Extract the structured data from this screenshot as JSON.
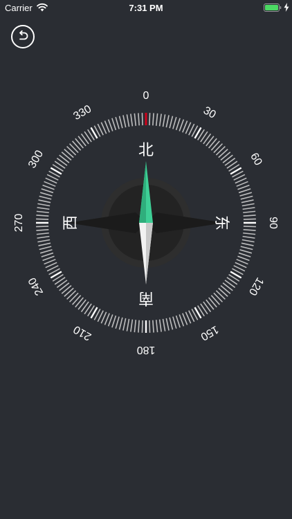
{
  "status_bar": {
    "carrier": "Carrier",
    "time": "7:31 PM",
    "icons": [
      "wifi-icon",
      "battery-icon",
      "charging-icon"
    ],
    "battery_color": "#4cd964"
  },
  "back_button": {
    "icon": "back-arrow-icon"
  },
  "compass": {
    "heading": 0,
    "degree_labels": [
      "0",
      "30",
      "60",
      "90",
      "120",
      "150",
      "180",
      "210",
      "240",
      "270",
      "300",
      "330"
    ],
    "directions": {
      "north": "北",
      "east": "东",
      "south": "南",
      "west": "西"
    },
    "colors": {
      "background": "#2a2d33",
      "tick": "#d8d8d8",
      "heading_marker": "#d0021b",
      "needle_north": "#3ecf96",
      "needle_south": "#f2f2f2"
    }
  }
}
